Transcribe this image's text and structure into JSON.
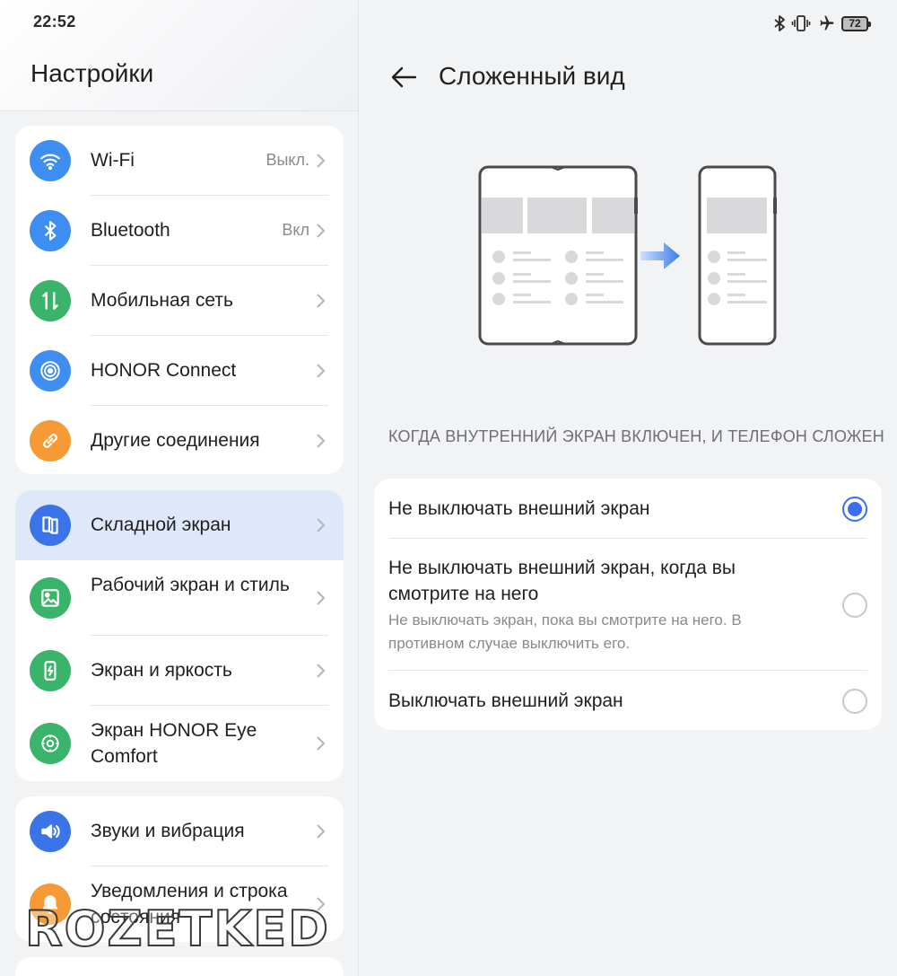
{
  "status_bar": {
    "time": "22:52",
    "battery": "72"
  },
  "settings": {
    "title": "Настройки",
    "groups": [
      {
        "items": [
          {
            "label": "Wi-Fi",
            "value": "Выкл.",
            "icon": "wifi-icon",
            "color": "#3d8ef0"
          },
          {
            "label": "Bluetooth",
            "value": "Вкл",
            "icon": "bluetooth-icon",
            "color": "#3d8ef0"
          },
          {
            "label": "Мобильная сеть",
            "value": "",
            "icon": "mobile-data-icon",
            "color": "#3ab46a"
          },
          {
            "label": "HONOR Connect",
            "value": "",
            "icon": "honor-connect-icon",
            "color": "#3d8ef0"
          },
          {
            "label": "Другие соединения",
            "value": "",
            "icon": "link-icon",
            "color": "#f59a34"
          }
        ]
      },
      {
        "items": [
          {
            "label": "Складной экран",
            "value": "",
            "icon": "foldable-icon",
            "color": "#3a74e8",
            "active": true
          },
          {
            "label": "Рабочий экран и стиль",
            "value": "",
            "icon": "image-icon",
            "color": "#3ab46a"
          },
          {
            "label": "Экран и яркость",
            "value": "",
            "icon": "brightness-icon",
            "color": "#3ab46a"
          },
          {
            "label": "Экран HONOR Eye Comfort",
            "value": "",
            "icon": "eye-comfort-icon",
            "color": "#3ab46a"
          }
        ]
      },
      {
        "items": [
          {
            "label": "Звуки и вибрация",
            "value": "",
            "icon": "volume-icon",
            "color": "#3a74e8"
          },
          {
            "label": "Уведомления и строка состояния",
            "value": "",
            "icon": "bell-icon",
            "color": "#f59a34"
          }
        ]
      }
    ]
  },
  "detail": {
    "title": "Сложенный вид",
    "section_label": "КОГДА ВНУТРЕННИЙ ЭКРАН ВКЛЮЧЕН, И ТЕЛЕФОН СЛОЖЕН",
    "options": [
      {
        "title": "Не выключать внешний экран",
        "subtitle": "",
        "selected": true
      },
      {
        "title": "Не выключать внешний экран, когда вы смотрите на него",
        "subtitle": "Не выключать экран, пока вы смотрите на него. В противном случае выключить его.",
        "selected": false
      },
      {
        "title": "Выключать внешний экран",
        "subtitle": "",
        "selected": false
      }
    ]
  },
  "watermark": "ROZETKED",
  "colors": {
    "accent": "#3c6ff0",
    "active_row": "#dfe8fb"
  }
}
